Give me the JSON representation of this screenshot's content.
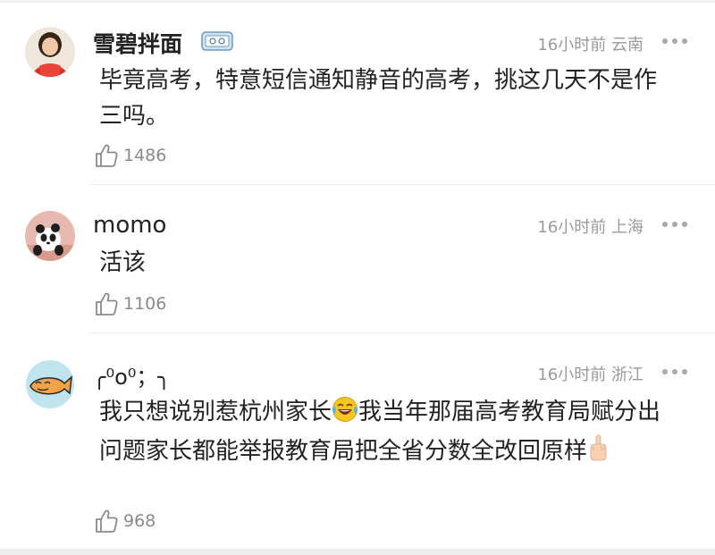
{
  "comments": [
    {
      "username": "雪碧拌面",
      "badge_icon": "vip-badge-icon",
      "time": "16小时前",
      "location": "云南",
      "content": "毕竟高考，特意短信通知静音的高考，挑这几天不是作三吗。",
      "likes": "1486"
    },
    {
      "username": "momo",
      "time": "16小时前",
      "location": "上海",
      "content": "活该",
      "likes": "1106"
    },
    {
      "username": "╭⁰o⁰；╮",
      "time": "16小时前",
      "location": "浙江",
      "content_part1": "我只想说别惹杭州家长",
      "content_emoji1": "laughing-crying-emoji-icon",
      "content_part2": "我当年那届高考教育局赋分出问题家长都能举报教育局把全省分数全改回原样",
      "content_emoji2": "middle-finger-emoji-icon",
      "likes": "968"
    }
  ],
  "colors": {
    "meta_text": "#9a9a9a",
    "like_count": "#8a8a8a",
    "divider": "#ececec"
  }
}
